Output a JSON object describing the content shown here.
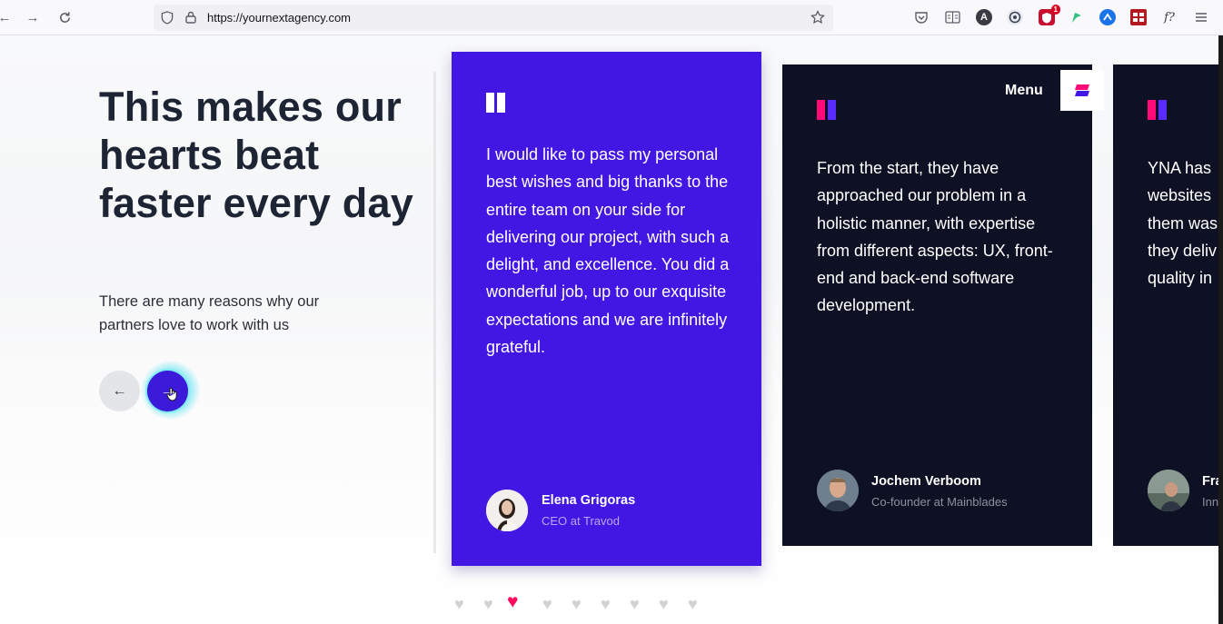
{
  "browser": {
    "url": "https://yournextagency.com",
    "icons": [
      "back-icon",
      "forward-icon",
      "reload-icon",
      "shield-icon",
      "lock-icon",
      "bookmark-star-icon",
      "pocket-icon",
      "reader-view-icon",
      "extension-a-icon",
      "extension-mask-icon",
      "extension-shield-icon",
      "extension-leaf-icon",
      "extension-circle-icon",
      "extension-grid-icon",
      "extension-font-icon",
      "hamburger-menu-icon"
    ],
    "badge_count": "1",
    "ext_a_label": "A",
    "ext_font_label": "f?"
  },
  "hero": {
    "headline": "This makes our hearts beat faster every day",
    "subline": "There are many reasons why our partners love to work with us",
    "prev_icon": "←",
    "next_icon": "→"
  },
  "menu": {
    "label": "Menu"
  },
  "testimonials": [
    {
      "quote": "I would like to pass my personal best wishes and big thanks to the entire team on your side for delivering our project, with such a delight, and excellence. You did a wonderful job, up to our exquisite expectations and we are infinitely grateful.",
      "name": "Elena Grigoras",
      "role": "CEO at Travod"
    },
    {
      "quote": "From the start, they have approached our problem in a holistic manner, with expertise from different aspects: UX, front-end and back-end software development.",
      "name": "Jochem Verboom",
      "role": "Co-founder at Mainblades"
    },
    {
      "quote": "YNA has websites them was they deliv quality in",
      "name": "Fra",
      "role": "Inn"
    }
  ],
  "pagination": {
    "count": 9,
    "active_index": 2,
    "active_color": "#ff0a5c",
    "inactive_color": "#d2d2d6"
  },
  "colors": {
    "accent": "#4317e3",
    "dark_card": "#0e1124",
    "heading": "#1d2433"
  }
}
